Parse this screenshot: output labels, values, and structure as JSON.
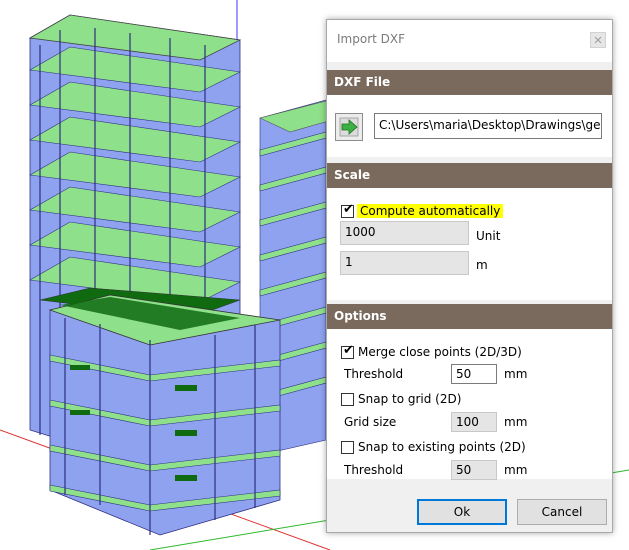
{
  "dialog": {
    "title": "Import DXF",
    "dxf_file": {
      "header": "DXF File",
      "path": "C:\\Users\\maria\\Desktop\\Drawings\\geom"
    },
    "scale": {
      "header": "Scale",
      "compute_auto_label": "Compute automatically",
      "compute_auto_checked": true,
      "value": "1000",
      "value_unit_label": "Unit",
      "ref_value": "1",
      "ref_unit_label": "m"
    },
    "options": {
      "header": "Options",
      "merge_label": "Merge close points (2D/3D)",
      "merge_checked": true,
      "merge_threshold_label": "Threshold",
      "merge_threshold_value": "50",
      "merge_threshold_unit": "mm",
      "snap_grid_label": "Snap to grid (2D)",
      "snap_grid_checked": false,
      "grid_size_label": "Grid size",
      "grid_size_value": "100",
      "grid_size_unit": "mm",
      "snap_points_label": "Snap to existing points (2D)",
      "snap_points_checked": false,
      "snap_threshold_label": "Threshold",
      "snap_threshold_value": "50",
      "snap_threshold_unit": "mm"
    },
    "buttons": {
      "ok": "Ok",
      "cancel": "Cancel"
    }
  },
  "colors": {
    "slab": "#8fe08a",
    "wall": "#8fa2f0",
    "dark_slab": "#0f6a10",
    "section_header": "#7a6a5d",
    "highlight": "#ffff00"
  },
  "icons": {
    "file_import": "green-arrow-icon",
    "close": "close-icon"
  }
}
